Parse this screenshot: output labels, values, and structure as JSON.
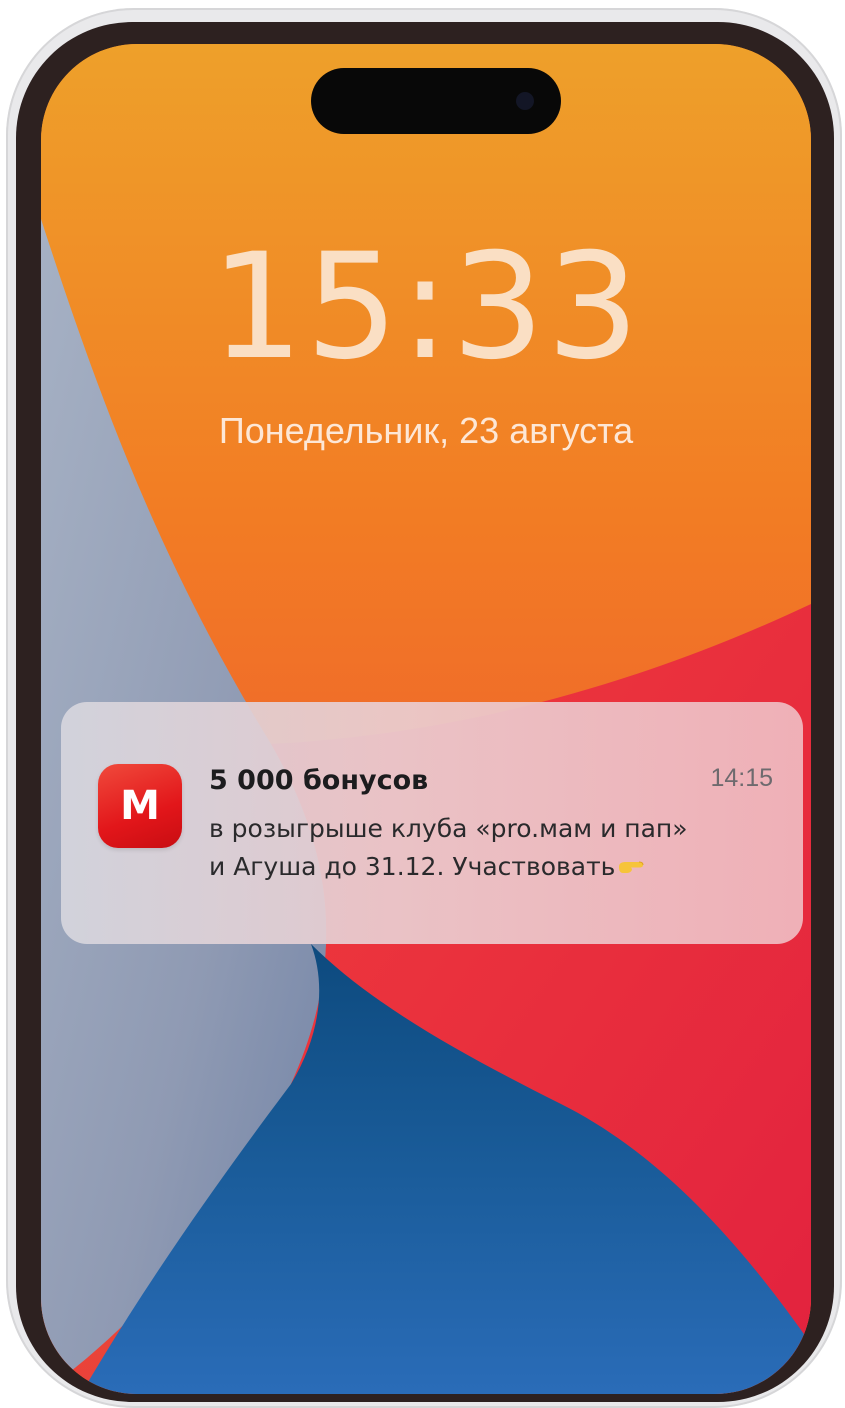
{
  "lockscreen": {
    "time": "15:33",
    "date": "Понедельник, 23 августа"
  },
  "notification": {
    "app_icon_letter": "M",
    "title": "5 000 бонусов",
    "time": "14:15",
    "body_line1": "в розыгрыше клуба «pro.мам и пап»",
    "body_line2": "и Агуша до 31.12. Участвовать",
    "emoji": "backhand-pointing-right-icon"
  },
  "colors": {
    "wallpaper_orange": "#f07a22",
    "wallpaper_red": "#e8283a",
    "wallpaper_blue": "#1e5c97",
    "wallpaper_slate": "#8c9cb4",
    "app_icon_red": "#e2161a"
  }
}
